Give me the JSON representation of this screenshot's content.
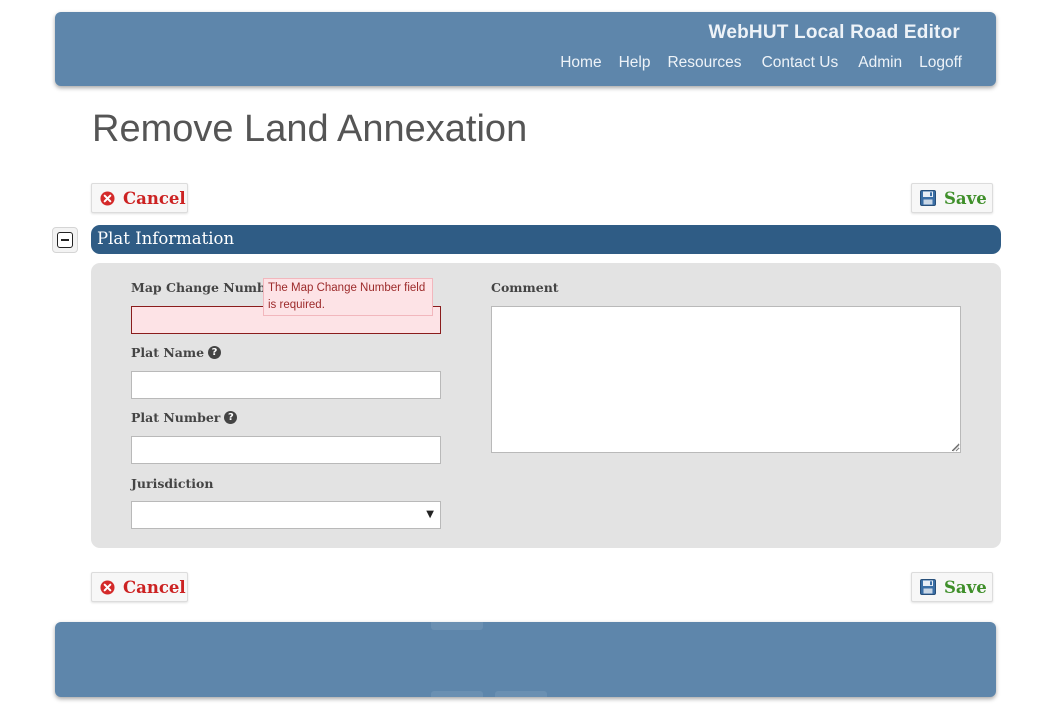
{
  "header": {
    "app_title": "WebHUT Local Road Editor",
    "nav": [
      "Home",
      "Help",
      "Resources",
      "Contact Us",
      "Admin",
      "Logoff"
    ]
  },
  "page": {
    "title": "Remove Land Annexation"
  },
  "actions": {
    "cancel_label": "Cancel",
    "save_label": "Save"
  },
  "section": {
    "title": "Plat Information"
  },
  "form": {
    "map_change_number": {
      "label": "Map Change Number",
      "value": "",
      "error": "The Map Change Number field is required."
    },
    "plat_name": {
      "label": "Plat Name",
      "value": ""
    },
    "plat_number": {
      "label": "Plat Number",
      "value": ""
    },
    "jurisdiction": {
      "label": "Jurisdiction",
      "selected": ""
    },
    "comment": {
      "label": "Comment",
      "value": ""
    }
  },
  "colors": {
    "header_bg": "#5e86ab",
    "section_bar": "#2f5c85",
    "cancel": "#cc2222",
    "save": "#3f8f2a",
    "error_bg": "#fde3e6"
  }
}
